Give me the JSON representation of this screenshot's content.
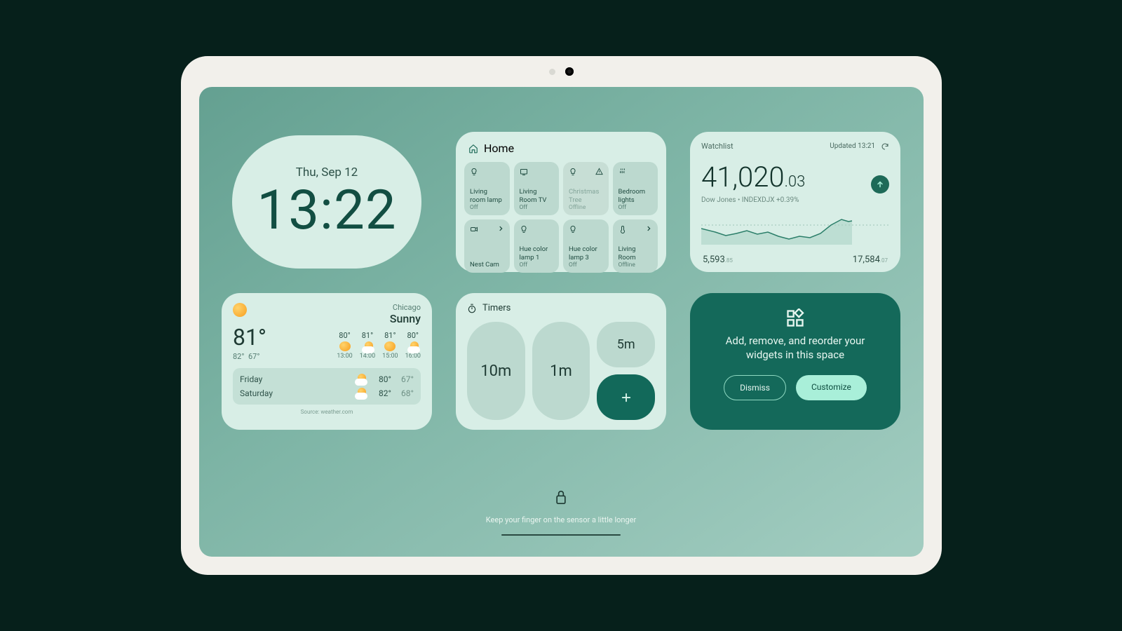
{
  "clock": {
    "date": "Thu, Sep 12",
    "time": "13:22"
  },
  "home": {
    "title": "Home",
    "tiles": [
      {
        "name": "Living room lamp",
        "state": "Off",
        "icon": "lightbulb",
        "extra": ""
      },
      {
        "name": "Living Room TV",
        "state": "Off",
        "icon": "tv",
        "extra": ""
      },
      {
        "name": "Christmas Tree",
        "state": "Offline",
        "icon": "lightbulb",
        "extra": "warning",
        "offline": true
      },
      {
        "name": "Bedroom lights",
        "state": "Off",
        "icon": "lights",
        "extra": ""
      },
      {
        "name": "Nest Cam",
        "state": "",
        "icon": "camera",
        "extra": "chevron"
      },
      {
        "name": "Hue color lamp 1",
        "state": "Off",
        "icon": "lightbulb",
        "extra": ""
      },
      {
        "name": "Hue color lamp 3",
        "state": "Off",
        "icon": "lightbulb",
        "extra": ""
      },
      {
        "name": "Living Room",
        "state": "Offline",
        "icon": "thermostat",
        "extra": "chevron"
      }
    ]
  },
  "watchlist": {
    "title": "Watchlist",
    "updated": "Updated 13:21",
    "value_int": "41,020",
    "value_dec": ".03",
    "detail": "Dow Jones • INDEXDJX +0.39%",
    "footer_left": "5,593",
    "footer_left_dec": ".85",
    "footer_right": "17,584",
    "footer_right_dec": ".07"
  },
  "chart_data": {
    "type": "line",
    "title": "Dow Jones intraday",
    "series": [
      {
        "name": "INDEXDJX",
        "values": [
          40980,
          40960,
          40940,
          40930,
          40955,
          40935,
          40950,
          40920,
          40900,
          40920,
          40910,
          40940,
          41000,
          41030,
          41020,
          41020
        ]
      }
    ],
    "ylim": [
      40880,
      41040
    ]
  },
  "weather": {
    "city": "Chicago",
    "condition": "Sunny",
    "temp": "81°",
    "high": "82°",
    "low": "67°",
    "hourly": [
      {
        "temp": "80°",
        "time": "13:00",
        "icon": "sun"
      },
      {
        "temp": "81°",
        "time": "14:00",
        "icon": "cloud-sun"
      },
      {
        "temp": "81°",
        "time": "15:00",
        "icon": "sun"
      },
      {
        "temp": "80°",
        "time": "16:00",
        "icon": "cloud-sun"
      }
    ],
    "forecast": [
      {
        "day": "Friday",
        "high": "80°",
        "low": "67°",
        "icon": "cloud-sun"
      },
      {
        "day": "Saturday",
        "high": "82°",
        "low": "68°",
        "icon": "cloud-sun"
      }
    ],
    "source": "Source: weather.com"
  },
  "timers": {
    "title": "Timers",
    "presets": [
      "10m",
      "1m",
      "5m"
    ]
  },
  "customize": {
    "text": "Add, remove, and reorder your widgets in this space",
    "dismiss": "Dismiss",
    "customize": "Customize"
  },
  "lock": {
    "hint": "Keep your finger on the sensor a little longer"
  }
}
